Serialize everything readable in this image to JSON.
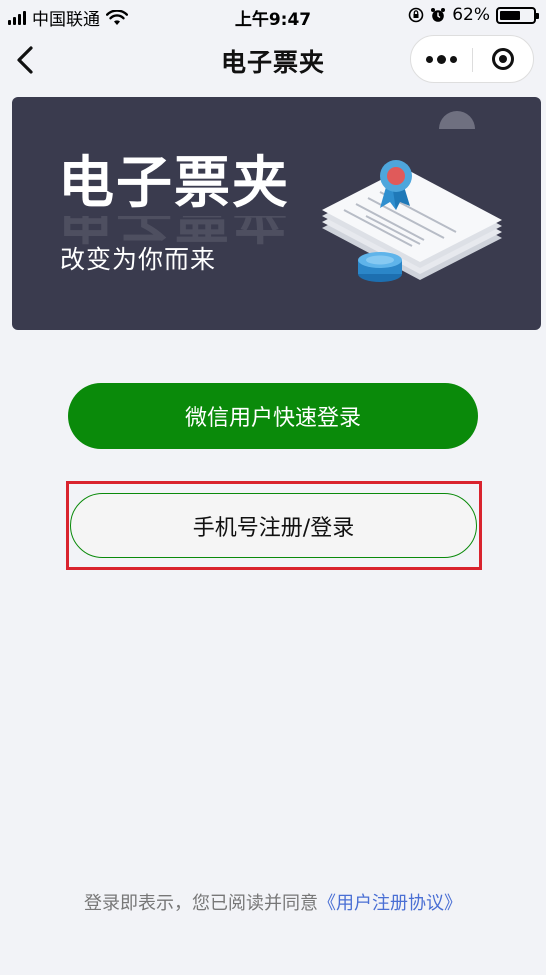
{
  "status_bar": {
    "carrier": "中国联通",
    "time": "上午9:47",
    "battery_percent": "62%",
    "battery_level": 0.62
  },
  "nav": {
    "title": "电子票夹",
    "back_icon": "chevron-left-icon",
    "more_icon": "more-dots-icon",
    "close_icon": "target-close-icon"
  },
  "banner": {
    "title": "电子票夹",
    "subtitle": "改变为你而来"
  },
  "buttons": {
    "wechat_login": "微信用户快速登录",
    "phone_login": "手机号注册/登录"
  },
  "footer": {
    "prefix": "登录即表示，您已阅读并同意",
    "agreement_link": "《用户注册协议》"
  },
  "colors": {
    "accent_green": "#0a8a0a",
    "banner_bg": "#3a3b4e",
    "highlight_red": "#d9232e",
    "link_blue": "#4a6fd4"
  }
}
